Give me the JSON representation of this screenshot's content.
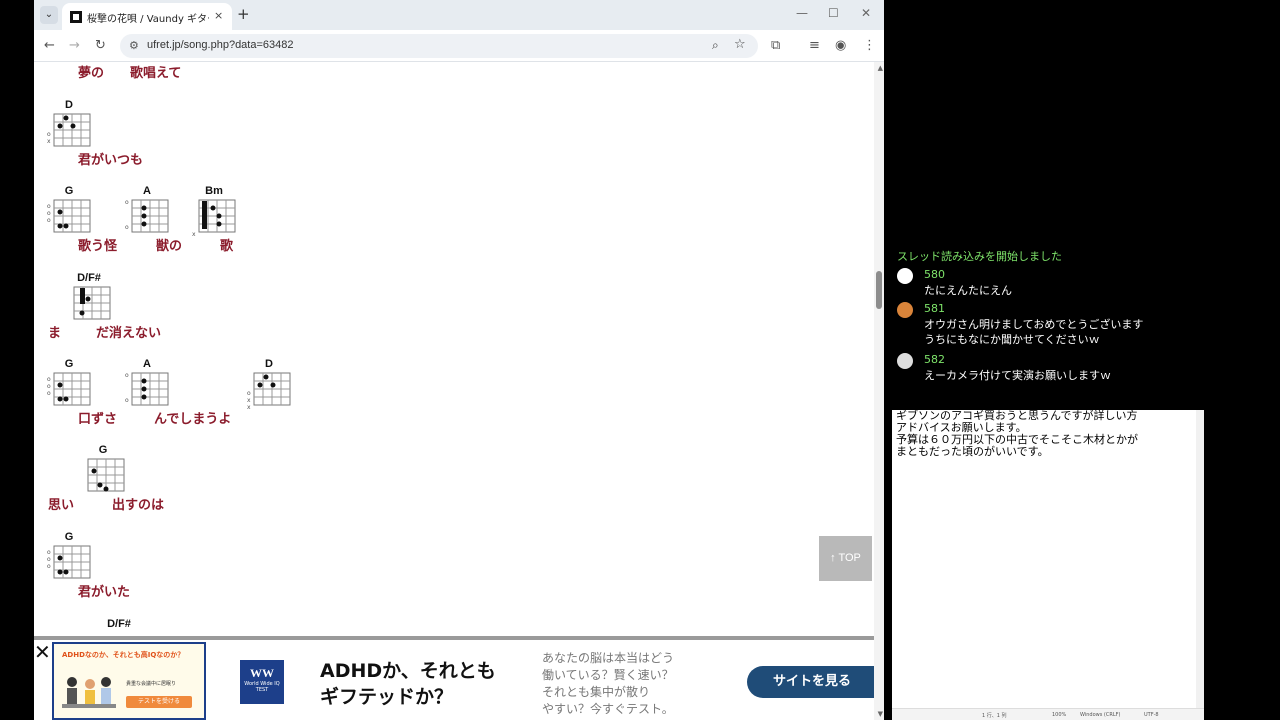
{
  "browser": {
    "tab_title": "桜撃の花唄 / Vaundy ギターコード/",
    "tab_close": "×",
    "new_tab": "+",
    "url": "ufret.jp/song.php?data=63482",
    "win_min": "—",
    "win_max": "☐",
    "win_close": "✕"
  },
  "lyrics": [
    {
      "id": "l1",
      "text": "夢の　　歌唱えて"
    },
    {
      "id": "l2",
      "text": "君がいつも"
    },
    {
      "id": "l3a",
      "text": "歌う怪"
    },
    {
      "id": "l3b",
      "text": "獣の"
    },
    {
      "id": "l3c",
      "text": "歌"
    },
    {
      "id": "l4a",
      "text": "ま"
    },
    {
      "id": "l4b",
      "text": "だ消えない"
    },
    {
      "id": "l5a",
      "text": "口ずさ"
    },
    {
      "id": "l5b",
      "text": "んでしまうよ"
    },
    {
      "id": "l6a",
      "text": "思い"
    },
    {
      "id": "l6b",
      "text": "出すのは"
    },
    {
      "id": "l7",
      "text": "君がいた"
    }
  ],
  "chords": [
    "D",
    "G",
    "A",
    "Bm",
    "D/F#",
    "G",
    "A",
    "D",
    "G",
    "G",
    "D/F#"
  ],
  "top_button": "↑ TOP",
  "ad": {
    "close": "✕",
    "image_title": "ADHDなのか、それとも高IQなのか？",
    "image_sub": "貴重な会議中に居眠り",
    "image_button": "テストを受ける",
    "logo_main": "WW",
    "logo_sub": "World Wide IQ TEST",
    "headline_1": "ADHDか、それとも",
    "headline_2": "ギフテッドか？",
    "body_1": "あなたの脳は本当はどう",
    "body_2": "働いている？賢く速い？",
    "body_3": "それとも集中が散り",
    "body_4": "やすい？今すぐテスト。",
    "cta": "サイトを見る"
  },
  "chat": {
    "status": "スレッド読み込みを開始しました",
    "messages": [
      {
        "num": "580",
        "lines": [
          "たにえんたにえん"
        ]
      },
      {
        "num": "581",
        "lines": [
          "オウガさん明けましておめでとうございます",
          "うちにもなにか聞かせてくださいｗ"
        ]
      },
      {
        "num": "582",
        "lines": [
          "えーカメラ付けて実演お願いしますｗ"
        ]
      }
    ]
  },
  "notepad": {
    "lines": [
      "ギブソンのアコギ買おうと思うんですが詳しい方",
      "アドバイスお願いします。",
      "予算は６０万円以下の中古でそこそこ木材とかが",
      "まともだった頃のがいいです。"
    ],
    "status_pos": "1 行、1 列",
    "status_zoom": "100%",
    "status_eol": "Windows (CRLF)",
    "status_enc": "UTF-8"
  },
  "colors": {
    "lyric": "#8b1c2c",
    "chat_green": "#7ee36a",
    "cta": "#1f4c78"
  }
}
